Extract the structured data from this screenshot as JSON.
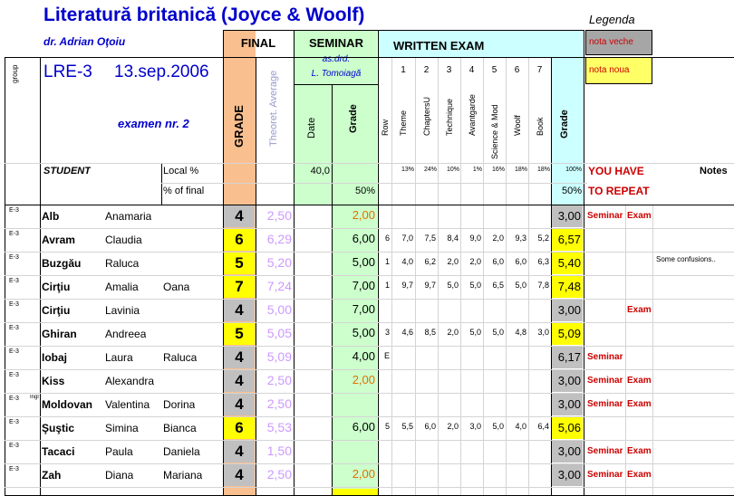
{
  "header": {
    "title": "Literatură britanică (Joyce & Woolf)",
    "author": "dr. Adrian Oţoiu",
    "course": "LRE-3",
    "date": "13.sep.2006",
    "exam": "examen nr. 2",
    "group_label": "group",
    "student_label": "STUDENT",
    "local_pct": "Local %",
    "pct_final": "% of final"
  },
  "legend": {
    "title": "Legenda",
    "old": "nota veche",
    "new": "nota noua",
    "old_color": "#a6a6a6",
    "new_color": "#ffff66"
  },
  "sections": {
    "final": "FINAL",
    "final_grade": "GRADE",
    "theoret": "Theoret. Average",
    "seminar": "SEMINAR",
    "seminar_sub1": "as.drd.",
    "seminar_sub2": "L. Tomoiagă",
    "date_col": "Date",
    "seminar_grade": "Grade",
    "seminar_local": "40,0",
    "seminar_pct": "50%",
    "written": "WRITTEN EXAM",
    "written_grade": "Grade",
    "written_local": "100%",
    "written_pct": "50%",
    "repeat1": "YOU HAVE",
    "repeat2": "TO REPEAT",
    "notes": "Notes"
  },
  "written_cols": [
    {
      "num": "",
      "label": "Row",
      "pct": ""
    },
    {
      "num": "1",
      "label": "Theme",
      "pct": "13%"
    },
    {
      "num": "2",
      "label": "ChaptersU",
      "pct": "24%"
    },
    {
      "num": "3",
      "label": "Technique",
      "pct": "10%"
    },
    {
      "num": "4",
      "label": "Avantgarde",
      "pct": "1%"
    },
    {
      "num": "5",
      "label": "Science & Mod",
      "pct": "16%"
    },
    {
      "num": "6",
      "label": "Woolf",
      "pct": "18%"
    },
    {
      "num": "7",
      "label": "Book",
      "pct": "18%"
    }
  ],
  "rows": [
    {
      "group": "E-3",
      "group2": "",
      "last": "Alb",
      "first": "Anamaria",
      "middle": "",
      "final": "4",
      "fcolor": "#c0c0c0",
      "theo": "2,50",
      "sem": "2,00",
      "semred": true,
      "w": [
        "",
        "",
        "",
        "",
        "",
        "",
        "",
        ""
      ],
      "wg": "3,00",
      "wgcolor": "#c0c0c0",
      "r1": "Seminar",
      "r2": "Exam",
      "note": ""
    },
    {
      "group": "E-3",
      "group2": "",
      "last": "Avram",
      "first": "Claudia",
      "middle": "",
      "final": "6",
      "fcolor": "#ffff00",
      "theo": "6,29",
      "sem": "6,00",
      "semred": false,
      "w": [
        "6",
        "7,0",
        "7,5",
        "8,4",
        "9,0",
        "2,0",
        "9,3",
        "5,2"
      ],
      "wg": "6,57",
      "wgcolor": "#ffff00",
      "r1": "",
      "r2": "",
      "note": ""
    },
    {
      "group": "E-3",
      "group2": "",
      "last": "Buzgău",
      "first": "Raluca",
      "middle": "",
      "final": "5",
      "fcolor": "#ffff00",
      "theo": "5,20",
      "sem": "5,00",
      "semred": false,
      "w": [
        "1",
        "4,0",
        "6,2",
        "2,0",
        "2,0",
        "6,0",
        "6,0",
        "6,3"
      ],
      "wg": "5,40",
      "wgcolor": "#ffff00",
      "r1": "",
      "r2": "",
      "note": "Some confusions.."
    },
    {
      "group": "E-3",
      "group2": "",
      "last": "Cirţiu",
      "first": "Amalia",
      "middle": "Oana",
      "final": "7",
      "fcolor": "#ffff00",
      "theo": "7,24",
      "sem": "7,00",
      "semred": false,
      "w": [
        "1",
        "9,7",
        "9,7",
        "5,0",
        "5,0",
        "6,5",
        "5,0",
        "7,8"
      ],
      "wg": "7,48",
      "wgcolor": "#ffff00",
      "r1": "",
      "r2": "",
      "note": ""
    },
    {
      "group": "E-3",
      "group2": "",
      "last": "Cirţiu",
      "first": "Lavinia",
      "middle": "",
      "final": "4",
      "fcolor": "#c0c0c0",
      "theo": "5,00",
      "sem": "7,00",
      "semred": false,
      "w": [
        "",
        "",
        "",
        "",
        "",
        "",
        "",
        ""
      ],
      "wg": "3,00",
      "wgcolor": "#c0c0c0",
      "r1": "",
      "r2": "Exam",
      "note": ""
    },
    {
      "group": "E-3",
      "group2": "",
      "last": "Ghiran",
      "first": "Andreea",
      "middle": "",
      "final": "5",
      "fcolor": "#ffff00",
      "theo": "5,05",
      "sem": "5,00",
      "semred": false,
      "w": [
        "3",
        "4,6",
        "8,5",
        "2,0",
        "5,0",
        "5,0",
        "4,8",
        "3,0"
      ],
      "wg": "5,09",
      "wgcolor": "#ffff00",
      "r1": "",
      "r2": "",
      "note": ""
    },
    {
      "group": "E-3",
      "group2": "",
      "last": "Iobaj",
      "first": "Laura",
      "middle": "Raluca",
      "final": "4",
      "fcolor": "#c0c0c0",
      "theo": "5,09",
      "sem": "4,00",
      "semred": false,
      "w": [
        "E",
        "",
        "",
        "",
        "",
        "",
        "",
        ""
      ],
      "wg": "6,17",
      "wgcolor": "#c0c0c0",
      "r1": "Seminar",
      "r2": "",
      "note": ""
    },
    {
      "group": "E-3",
      "group2": "",
      "last": "Kiss",
      "first": "Alexandra",
      "middle": "",
      "final": "4",
      "fcolor": "#c0c0c0",
      "theo": "2,50",
      "sem": "2,00",
      "semred": true,
      "w": [
        "",
        "",
        "",
        "",
        "",
        "",
        "",
        ""
      ],
      "wg": "3,00",
      "wgcolor": "#c0c0c0",
      "r1": "Seminar",
      "r2": "Exam",
      "note": ""
    },
    {
      "group": "E-3",
      "group2": "Ingl",
      "last": "Moldovan",
      "first": "Valentina",
      "middle": "Dorina",
      "final": "4",
      "fcolor": "#c0c0c0",
      "theo": "2,50",
      "sem": "",
      "semred": false,
      "w": [
        "",
        "",
        "",
        "",
        "",
        "",
        "",
        ""
      ],
      "wg": "3,00",
      "wgcolor": "#c0c0c0",
      "r1": "Seminar",
      "r2": "Exam",
      "note": ""
    },
    {
      "group": "E-3",
      "group2": "",
      "last": "Şuştic",
      "first": "Simina",
      "middle": "Bianca",
      "final": "6",
      "fcolor": "#ffff00",
      "theo": "5,53",
      "sem": "6,00",
      "semred": false,
      "w": [
        "5",
        "5,5",
        "6,0",
        "2,0",
        "3,0",
        "5,0",
        "4,0",
        "6,4"
      ],
      "wg": "5,06",
      "wgcolor": "#ffff00",
      "r1": "",
      "r2": "",
      "note": ""
    },
    {
      "group": "E-3",
      "group2": "",
      "last": "Tacaci",
      "first": "Paula",
      "middle": "Daniela",
      "final": "4",
      "fcolor": "#c0c0c0",
      "theo": "1,50",
      "sem": "",
      "semred": false,
      "w": [
        "",
        "",
        "",
        "",
        "",
        "",
        "",
        ""
      ],
      "wg": "3,00",
      "wgcolor": "#c0c0c0",
      "r1": "Seminar",
      "r2": "Exam",
      "note": ""
    },
    {
      "group": "E-3",
      "group2": "",
      "last": "Zah",
      "first": "Diana",
      "middle": "Mariana",
      "final": "4",
      "fcolor": "#c0c0c0",
      "theo": "2,50",
      "sem": "2,00",
      "semred": true,
      "w": [
        "",
        "",
        "",
        "",
        "",
        "",
        "",
        ""
      ],
      "wg": "3,00",
      "wgcolor": "#c0c0c0",
      "r1": "Seminar",
      "r2": "Exam",
      "note": ""
    }
  ]
}
